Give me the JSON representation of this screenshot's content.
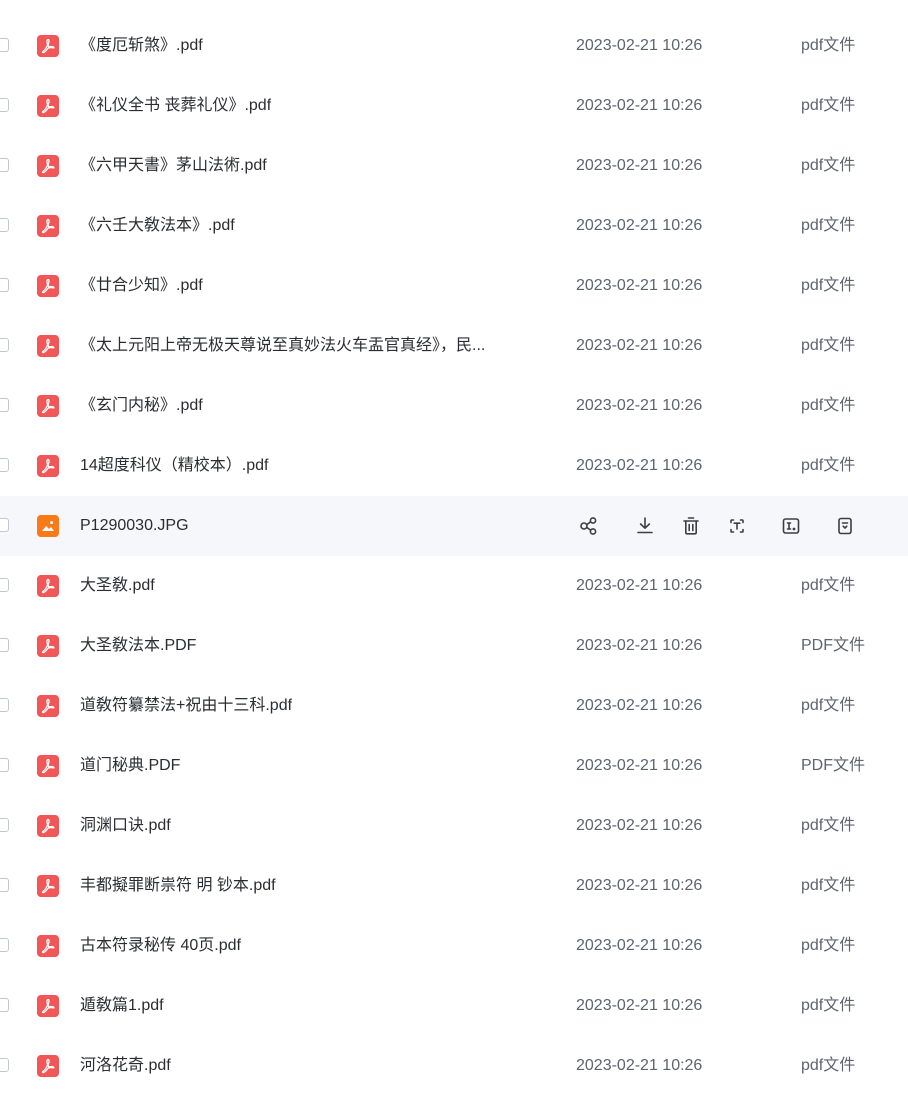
{
  "files": [
    {
      "name": "《度厄斩煞》.pdf",
      "date": "2023-02-21 10:26",
      "type": "pdf文件",
      "icon": "pdf-icon"
    },
    {
      "name": "《礼仪全书 丧葬礼仪》.pdf",
      "date": "2023-02-21 10:26",
      "type": "pdf文件",
      "icon": "pdf-icon"
    },
    {
      "name": "《六甲天書》茅山法術.pdf",
      "date": "2023-02-21 10:26",
      "type": "pdf文件",
      "icon": "pdf-icon"
    },
    {
      "name": "《六壬大敎法本》.pdf",
      "date": "2023-02-21 10:26",
      "type": "pdf文件",
      "icon": "pdf-icon"
    },
    {
      "name": "《廿合少知》.pdf",
      "date": "2023-02-21 10:26",
      "type": "pdf文件",
      "icon": "pdf-icon"
    },
    {
      "name": "《太上元阳上帝无极天尊说至真妙法火车盂官真经》，民...",
      "date": "2023-02-21 10:26",
      "type": "pdf文件",
      "icon": "pdf-icon"
    },
    {
      "name": "《玄门内秘》.pdf",
      "date": "2023-02-21 10:26",
      "type": "pdf文件",
      "icon": "pdf-icon"
    },
    {
      "name": "14超度科仪（精校本）.pdf",
      "date": "2023-02-21 10:26",
      "type": "pdf文件",
      "icon": "pdf-icon"
    },
    {
      "name": "P1290030.JPG",
      "date": "",
      "type": "",
      "icon": "image-icon",
      "hovered": true
    },
    {
      "name": "大圣敎.pdf",
      "date": "2023-02-21 10:26",
      "type": "pdf文件",
      "icon": "pdf-icon"
    },
    {
      "name": "大圣敎法本.PDF",
      "date": "2023-02-21 10:26",
      "type": "PDF文件",
      "icon": "pdf-icon"
    },
    {
      "name": "道敎符纂禁法+祝由十三科.pdf",
      "date": "2023-02-21 10:26",
      "type": "pdf文件",
      "icon": "pdf-icon"
    },
    {
      "name": "道门秘典.PDF",
      "date": "2023-02-21 10:26",
      "type": "PDF文件",
      "icon": "pdf-icon"
    },
    {
      "name": "洞渊口诀.pdf",
      "date": "2023-02-21 10:26",
      "type": "pdf文件",
      "icon": "pdf-icon"
    },
    {
      "name": "丰都擬罪断祟符 明 钞本.pdf",
      "date": "2023-02-21 10:26",
      "type": "pdf文件",
      "icon": "pdf-icon"
    },
    {
      "name": "古本符录秘传 40页.pdf",
      "date": "2023-02-21 10:26",
      "type": "pdf文件",
      "icon": "pdf-icon"
    },
    {
      "name": "遁敎篇1.pdf",
      "date": "2023-02-21 10:26",
      "type": "pdf文件",
      "icon": "pdf-icon"
    },
    {
      "name": "河洛花奇.pdf",
      "date": "2023-02-21 10:26",
      "type": "pdf文件",
      "icon": "pdf-icon"
    }
  ],
  "row_actions": [
    {
      "name": "share-icon"
    },
    {
      "name": "download-icon"
    },
    {
      "name": "delete-icon"
    },
    {
      "name": "scan-text-icon"
    },
    {
      "name": "text-recognition-icon"
    },
    {
      "name": "more-options-icon"
    }
  ],
  "colors": {
    "pdf_icon": "#f25757",
    "image_icon": "#fa7a1a",
    "hover_row": "#f5f7fa",
    "text_primary": "#2b2d33",
    "text_secondary": "#5e6370"
  }
}
